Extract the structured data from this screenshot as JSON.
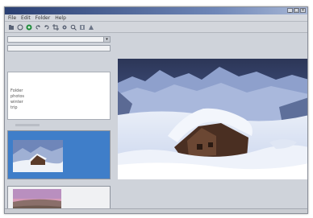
{
  "window": {
    "title": "",
    "buttons": [
      "_",
      "□",
      "×"
    ]
  },
  "menubar": {
    "items": [
      "File",
      "Edit",
      "Folder",
      "Help"
    ]
  },
  "toolbar": {
    "icons": [
      "open-icon",
      "back-icon",
      "green-circle-icon",
      "rotate-left-icon",
      "rotate-right-icon",
      "crop-icon",
      "settings-icon",
      "zoom-icon",
      "help-icon",
      "info-icon"
    ]
  },
  "sidebar": {
    "combo1_value": "",
    "combo2_value": "",
    "folders": [
      "Folder",
      "photos",
      "winter",
      "trip"
    ]
  },
  "thumbnails": [
    {
      "name": "",
      "selected": true
    },
    {
      "name": "",
      "selected": false
    }
  ],
  "colors": {
    "accent": "#3f7ec9",
    "title_bar": "#2a3f72"
  }
}
